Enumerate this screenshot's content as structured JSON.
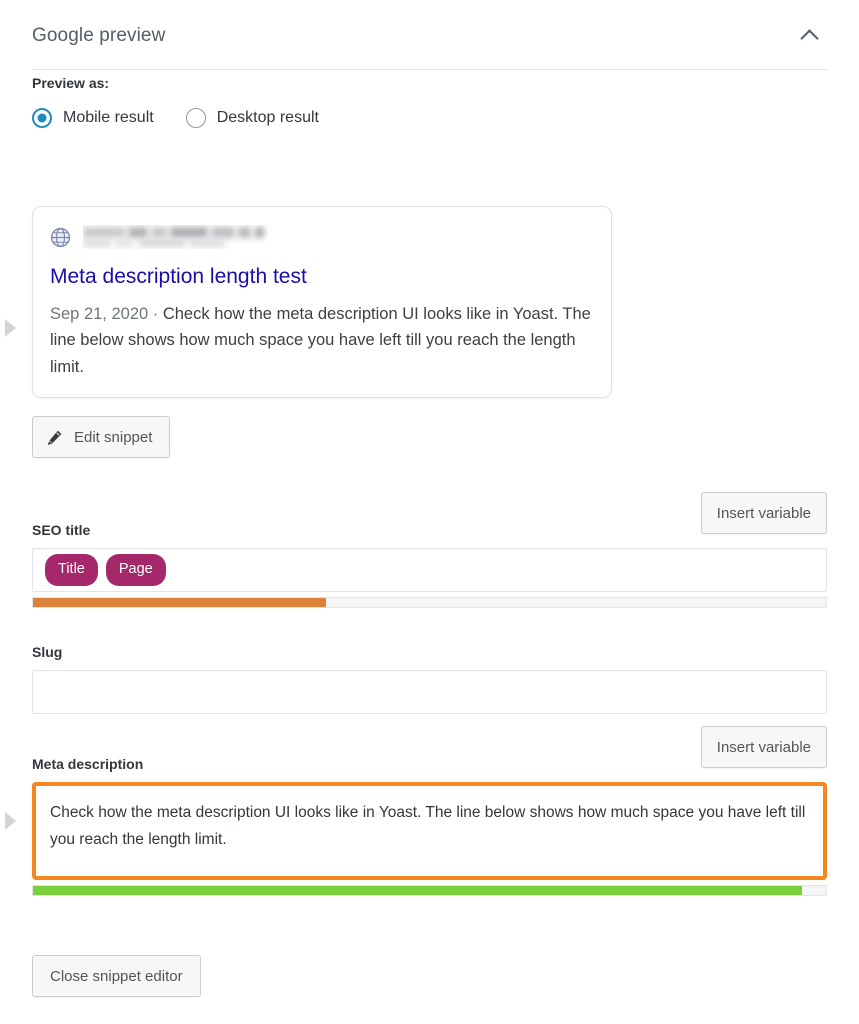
{
  "panel": {
    "title": "Google preview",
    "collapse_icon": "chevron-up-icon"
  },
  "preview_as": {
    "label": "Preview as:",
    "options": [
      {
        "label": "Mobile result",
        "selected": true
      },
      {
        "label": "Desktop result",
        "selected": false
      }
    ],
    "selected_color": "#1e8cbe"
  },
  "snippet_preview": {
    "favicon_icon": "globe-icon",
    "url": "",
    "url_redacted": true,
    "title": "Meta description length test",
    "title_color": "#1a0dab",
    "date": "Sep 21, 2020",
    "separator": "·",
    "description": "Check how the meta description UI looks like in Yoast. The line below shows how much space you have left till you reach the length limit."
  },
  "edit_snippet": {
    "label": "Edit snippet",
    "icon": "pencil-icon"
  },
  "seo_title": {
    "label": "SEO title",
    "insert_variable_label": "Insert variable",
    "variables": [
      "Title",
      "Page"
    ],
    "variable_color": "#a4286a",
    "progress": {
      "percent": 37,
      "color": "#dd823b"
    }
  },
  "slug": {
    "label": "Slug",
    "value": "",
    "placeholder": ""
  },
  "meta_description": {
    "label": "Meta description",
    "insert_variable_label": "Insert variable",
    "value": "Check how the meta description UI looks like in Yoast. The line below shows how much space you have left till you reach the length limit.",
    "focus_border_color": "#f6861f",
    "progress": {
      "percent": 97,
      "color": "#7ad03a"
    }
  },
  "close_editor": {
    "label": "Close snippet editor"
  }
}
